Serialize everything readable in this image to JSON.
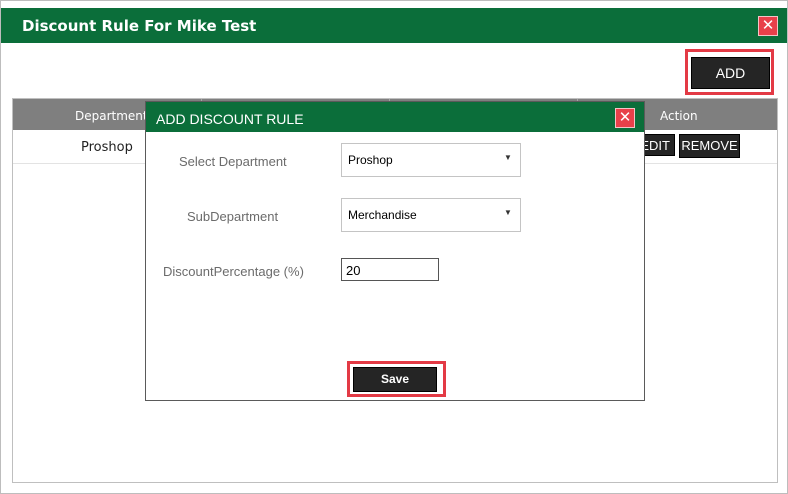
{
  "window": {
    "title": "Discount Rule For Mike Test",
    "close_glyph": "✕"
  },
  "toolbar": {
    "add_label": "ADD"
  },
  "grid": {
    "columns": [
      "Department",
      "Action"
    ],
    "rows": [
      {
        "department": "Proshop",
        "edit_label": "EDIT",
        "remove_label": "REMOVE"
      }
    ]
  },
  "dialog": {
    "title": "ADD DISCOUNT RULE",
    "close_glyph": "✕",
    "fields": {
      "department_label": "Select Department",
      "department_value": "Proshop",
      "subdepartment_label": "SubDepartment",
      "subdepartment_value": "Merchandise",
      "discount_label": "DiscountPercentage (%)",
      "discount_value": "20"
    },
    "save_label": "Save"
  },
  "colors": {
    "brand_green": "#0b6e3a",
    "highlight_red": "#e33a45",
    "dark_button": "#252525"
  }
}
